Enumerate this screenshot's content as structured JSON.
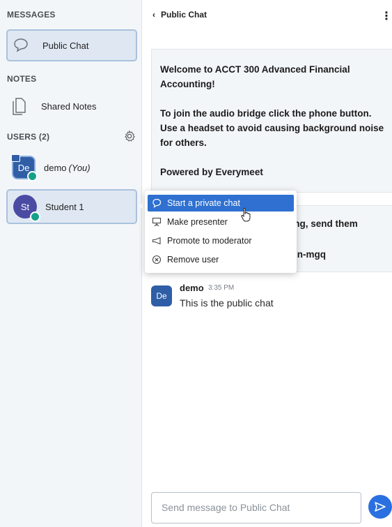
{
  "sidebar": {
    "messages_title": "MESSAGES",
    "public_chat_label": "Public Chat",
    "notes_title": "NOTES",
    "shared_notes_label": "Shared Notes",
    "users_title": "USERS (2)",
    "users": [
      {
        "initials": "De",
        "name": "demo",
        "you": "(You)"
      },
      {
        "initials": "St",
        "name": "Student 1"
      }
    ]
  },
  "chat": {
    "header_title": "Public Chat",
    "welcome": {
      "line1": "Welcome to ACCT 300 Advanced Financial Accounting!",
      "line2": "To join the audio bridge click the phone button. Use a headset to avoid causing background noise for others.",
      "line3": "Powered by Everymeet"
    },
    "moderator_partial_1": "ting, send them",
    "moderator_partial_2": "(nn-mgq",
    "message": {
      "initials": "De",
      "name": "demo",
      "time": "3:35 PM",
      "text": "This is the public chat"
    },
    "input_placeholder": "Send message to Public Chat"
  },
  "context_menu": {
    "items": [
      {
        "label": "Start a private chat",
        "icon": "chat-bubble-icon"
      },
      {
        "label": "Make presenter",
        "icon": "presentation-icon"
      },
      {
        "label": "Promote to moderator",
        "icon": "megaphone-icon"
      },
      {
        "label": "Remove user",
        "icon": "remove-circle-icon"
      }
    ]
  },
  "colors": {
    "accent": "#2f70d0",
    "selected": "#dfe8f2",
    "badge": "#16a08a"
  }
}
